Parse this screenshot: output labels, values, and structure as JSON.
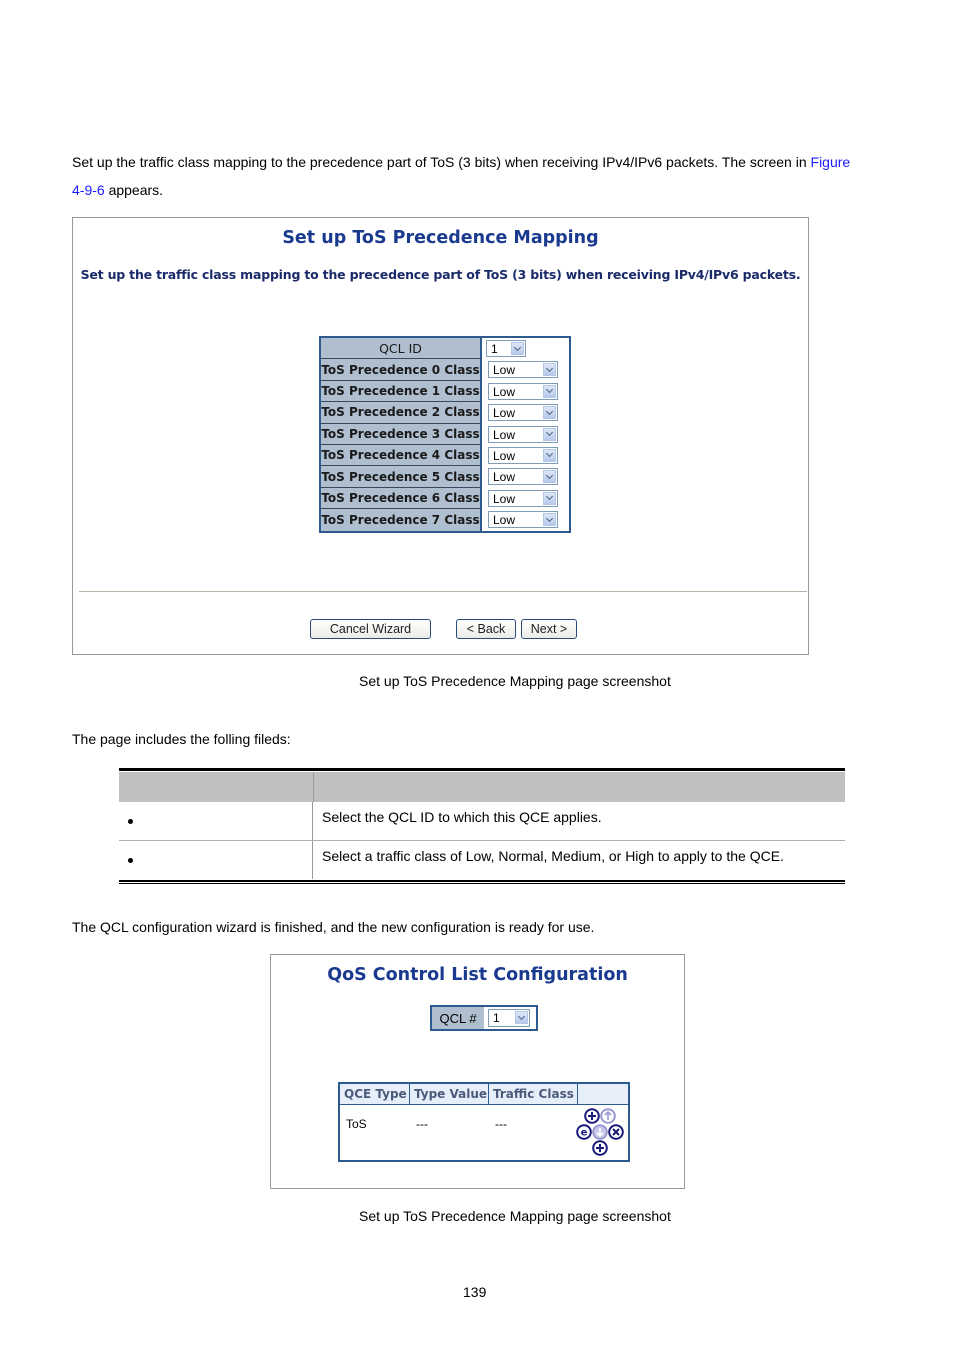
{
  "intro": {
    "text": "Set up the traffic class mapping to the precedence part of ToS (3 bits) when receiving IPv4/IPv6 packets. The screen in ",
    "link_line1": "Figure",
    "link_line2": "4-9-6",
    "text_after": " appears."
  },
  "shot1": {
    "title": "Set up ToS Precedence Mapping",
    "description": "Set up the traffic class mapping to the precedence part of ToS (3 bits) when receiving IPv4/IPv6 packets.",
    "qcl_label": "QCL ID",
    "qcl_value": "1",
    "rows": [
      {
        "label": "ToS Precedence 0 Class",
        "value": "Low"
      },
      {
        "label": "ToS Precedence 1 Class",
        "value": "Low"
      },
      {
        "label": "ToS Precedence 2 Class",
        "value": "Low"
      },
      {
        "label": "ToS Precedence 3 Class",
        "value": "Low"
      },
      {
        "label": "ToS Precedence 4 Class",
        "value": "Low"
      },
      {
        "label": "ToS Precedence 5 Class",
        "value": "Low"
      },
      {
        "label": "ToS Precedence 6 Class",
        "value": "Low"
      },
      {
        "label": "ToS Precedence 7 Class",
        "value": "Low"
      }
    ],
    "buttons": {
      "cancel": "Cancel Wizard",
      "back": "< Back",
      "next": "Next >"
    }
  },
  "caption1": "Set up ToS Precedence Mapping page screenshot",
  "fields_intro": "The page includes the folling fileds:",
  "fields_table": {
    "header": [
      "",
      ""
    ],
    "rows": [
      {
        "object": "",
        "description": "Select the QCL ID to which this QCE applies."
      },
      {
        "object": "",
        "description": "Select a traffic class of Low, Normal, Medium, or High to apply to the QCE."
      }
    ]
  },
  "finish_text": "The QCL configuration wizard is finished, and the new configuration is ready for use.",
  "shot2": {
    "title": "QoS Control List Configuration",
    "qcl_label": "QCL #",
    "qcl_value": "1",
    "columns": [
      "QCE Type",
      "Type Value",
      "Traffic Class",
      ""
    ],
    "rows": [
      {
        "qce_type": "ToS",
        "type_value": "---",
        "traffic_class": "---"
      }
    ],
    "controls": [
      "insert",
      "move-up",
      "edit",
      "move-down",
      "delete",
      "add"
    ]
  },
  "caption2": "Set up ToS Precedence Mapping page screenshot",
  "page_number": "139",
  "colors": {
    "title_blue": "#1a3a8f",
    "table_border": "#2d5b8e",
    "label_bg": "#b0bfcf",
    "link": "#1a1aff"
  }
}
